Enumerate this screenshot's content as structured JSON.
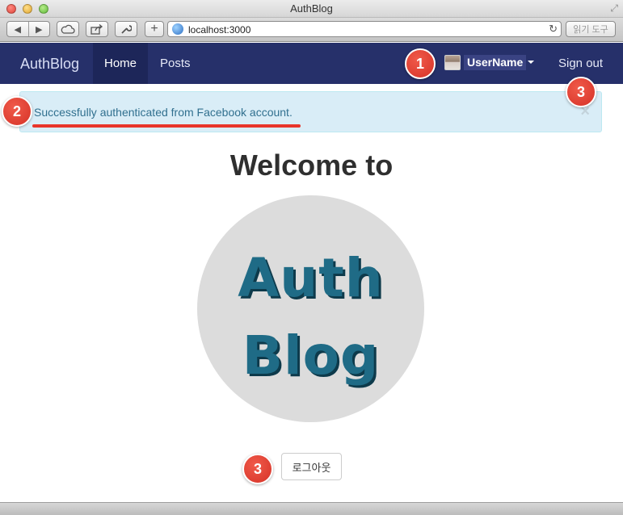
{
  "window": {
    "title": "AuthBlog"
  },
  "browser": {
    "url": "localhost:3000",
    "reader_label": "읽기 도구",
    "icons": {
      "back": "back-arrow-icon",
      "forward": "forward-arrow-icon",
      "cloud": "cloud-icon",
      "share": "share-icon",
      "tools": "wrench-icon",
      "add": "plus-icon",
      "reload": "reload-icon",
      "globe": "globe-icon"
    }
  },
  "navbar": {
    "brand": "AuthBlog",
    "links": [
      {
        "label": "Home",
        "active": true
      },
      {
        "label": "Posts",
        "active": false
      }
    ],
    "user": {
      "name": "UserName"
    },
    "signout": "Sign out",
    "background": "#26306a"
  },
  "alert": {
    "message": "Successfully authenticated from Facebook account.",
    "close": "×",
    "background": "#d9edf7",
    "text_color": "#31708f"
  },
  "main": {
    "heading": "Welcome to",
    "logo_lines": [
      "Auth",
      "Blog"
    ],
    "logout_button": "로그아웃"
  },
  "markers": [
    "1",
    "2",
    "3",
    "3"
  ],
  "colors": {
    "marker": "#d63227",
    "underline": "#e8352a"
  }
}
